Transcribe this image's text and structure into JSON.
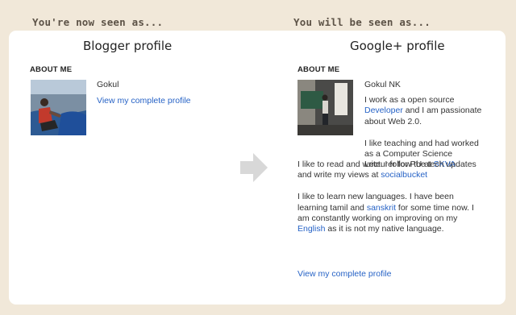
{
  "header": {
    "left_title": "You're now seen as...",
    "right_title": "You will be seen as..."
  },
  "left": {
    "title": "Blogger profile",
    "section": "ABOUT ME",
    "name": "Gokul",
    "link": "View my complete profile"
  },
  "right": {
    "title": "Google+ profile",
    "section": "ABOUT ME",
    "name": "Gokul NK",
    "bio": {
      "p1_pre": "I work as a open source ",
      "p1_link": "Developer",
      "p1_post": " and I am passionate about Web 2.0.",
      "p2_pre": "I like teaching and had worked as a Computer Science Lecturer for PU at ",
      "p2_link": "SKVA",
      "p3_pre": "I like to read and write. I follow the tech updates and write my views at ",
      "p3_link": "socialbucket",
      "p4_pre": "I like to learn new languages. I have been learning tamil and ",
      "p4_link1": "sanskrit",
      "p4_mid": " for some time now. I am constantly working on improving on my ",
      "p4_link2": "English",
      "p4_post": " as it is not my native language."
    },
    "link": "View my complete profile"
  },
  "icons": {
    "arrow": "right-arrow-icon"
  },
  "colors": {
    "background": "#f1e8d9",
    "card": "#ffffff",
    "link": "#2763c6",
    "arrow": "#d8d8d8"
  }
}
